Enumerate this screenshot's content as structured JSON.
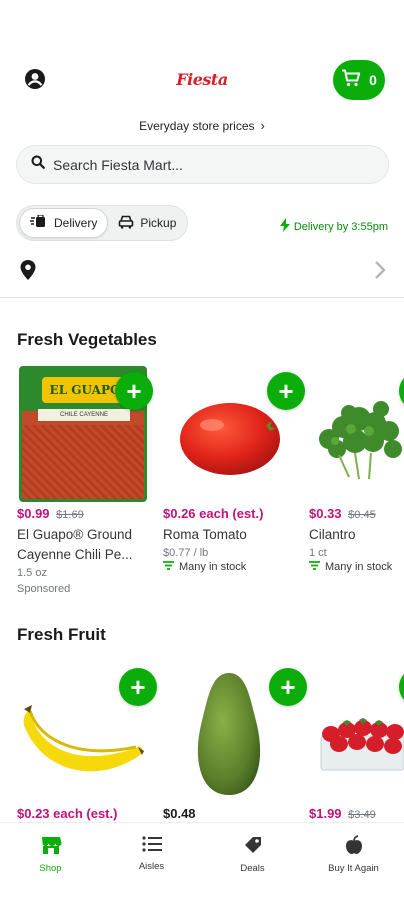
{
  "header": {
    "logo_text": "Fiesta",
    "cart_count": "0",
    "account_icon": "account-circle-icon",
    "cart_icon": "cart-icon"
  },
  "store_prices": {
    "label": "Everyday store prices",
    "chevron": "›"
  },
  "search": {
    "placeholder": "Search Fiesta Mart..."
  },
  "fulfillment": {
    "delivery_label": "Delivery",
    "pickup_label": "Pickup",
    "selected": "Delivery",
    "delivery_by": "Delivery by 3:55pm"
  },
  "sections": [
    {
      "title": "Fresh Vegetables",
      "products": [
        {
          "price": "$0.99",
          "old_price": "$1.69",
          "name": "El Guapo® Ground Cayenne Chili Pe...",
          "size": "1.5 oz",
          "sponsored": "Sponsored",
          "package_label": "EL GUAPO",
          "package_sub": "CHILE CAYENNE"
        },
        {
          "price": "$0.26 each (est.)",
          "name": "Roma Tomato",
          "size": "$0.77 / lb",
          "stock": "Many in stock"
        },
        {
          "price": "$0.33",
          "old_price": "$0.45",
          "name": "Cilantro",
          "size": "1 ct",
          "stock": "Many in stock"
        }
      ]
    },
    {
      "title": "Fresh Fruit",
      "products": [
        {
          "price": "$0.23 each (est.)"
        },
        {
          "price": "$0.48"
        },
        {
          "price": "$1.99",
          "old_price": "$3.49"
        }
      ]
    }
  ],
  "bottom_nav": [
    {
      "label": "Shop",
      "icon": "storefront-icon",
      "active": true
    },
    {
      "label": "Aisles",
      "icon": "list-icon",
      "active": false
    },
    {
      "label": "Deals",
      "icon": "tag-icon",
      "active": false
    },
    {
      "label": "Buy It Again",
      "icon": "apple-icon",
      "active": false
    }
  ],
  "colors": {
    "accent": "#0aad0a",
    "sale_price": "#c0117d",
    "logo": "#d8202a"
  }
}
